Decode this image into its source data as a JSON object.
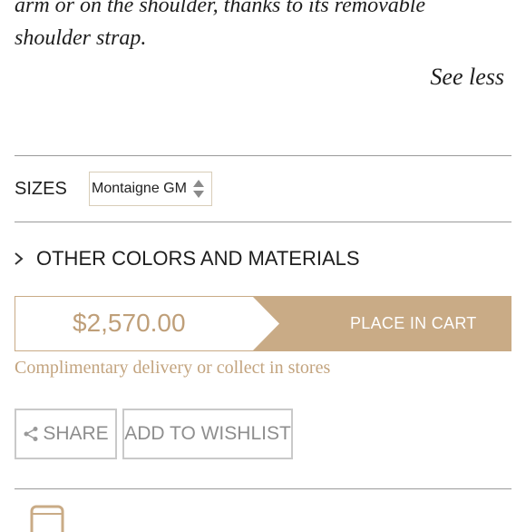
{
  "description": {
    "line1": "arm or on the shoulder, thanks to its removable",
    "line2": "shoulder strap."
  },
  "see_less_label": "See less",
  "sizes": {
    "label": "SIZES",
    "selected": "Montaigne GM"
  },
  "other_colors_label": "OTHER COLORS AND MATERIALS",
  "price": "$2,570.00",
  "place_in_cart_label": "PLACE IN CART",
  "delivery_note": "Complimentary delivery or collect in stores",
  "share_label": "SHARE",
  "wishlist_label": "ADD TO WISHLIST",
  "colors": {
    "accent": "#c4a47c",
    "cart_bg": "#c9ab86",
    "price_text": "#bf9f79",
    "button_text": "#8e8e8e"
  },
  "icons": {
    "share": "share-icon",
    "chevron": "chevron-right-icon",
    "phone": "phone-icon",
    "select_arrows": "up-down-arrows-icon"
  }
}
